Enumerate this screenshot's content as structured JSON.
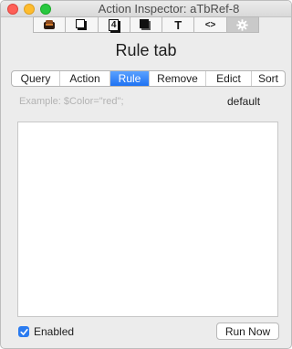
{
  "window": {
    "title": "Action Inspector: aTbRef-8"
  },
  "toolbar": {
    "buttons": [
      {
        "icon": "box-icon",
        "glyph": ""
      },
      {
        "icon": "white-square-icon",
        "glyph": ""
      },
      {
        "icon": "number-4-icon",
        "glyph": "4"
      },
      {
        "icon": "black-square-icon",
        "glyph": ""
      },
      {
        "icon": "text-t-icon",
        "glyph": "T"
      },
      {
        "icon": "code-brackets-icon",
        "glyph": "<>"
      },
      {
        "icon": "gear-icon",
        "glyph": ""
      }
    ],
    "active_index": 6
  },
  "heading": "Rule tab",
  "tabs": [
    {
      "label": "Query"
    },
    {
      "label": "Action"
    },
    {
      "label": "Rule"
    },
    {
      "label": "Remove"
    },
    {
      "label": "Edict"
    },
    {
      "label": "Sort"
    }
  ],
  "active_tab": "Rule",
  "rule": {
    "placeholder": "Example: $Color=\"red\";",
    "default_label": "default",
    "code": ""
  },
  "footer": {
    "enabled_label": "Enabled",
    "enabled_checked": true,
    "run_now_label": "Run Now"
  },
  "colors": {
    "accent": "#1f72f2",
    "window_bg": "#ececec"
  }
}
